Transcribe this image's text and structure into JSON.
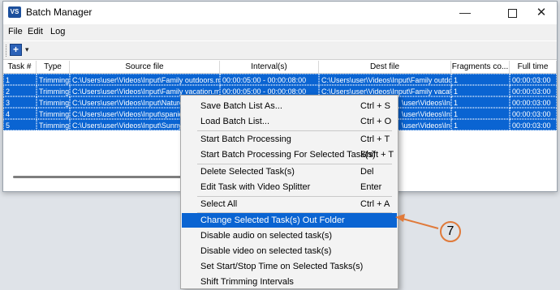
{
  "window": {
    "title": "Batch Manager",
    "app_icon": "VS"
  },
  "window_controls": {
    "minimize": "—",
    "close": "✕"
  },
  "menu": [
    "File",
    "Edit",
    "Log"
  ],
  "toolbar": {
    "add_icon": "+",
    "dropdown_icon": "▾"
  },
  "table": {
    "columns": [
      "Task #",
      "Type",
      "Source file",
      "Interval(s)",
      "Dest file",
      "Fragments co...",
      "Full time"
    ],
    "rows": [
      [
        "1",
        "Trimming",
        "C:\\Users\\user\\Videos\\Input\\Family outdoors.mp",
        "00:00:05:00 - 00:00:08:00",
        "C:\\Users\\user\\Videos\\Input\\Family outdo",
        "1",
        "00:00:03:00"
      ],
      [
        "2",
        "Trimming",
        "C:\\Users\\user\\Videos\\Input\\Family vacation.mp",
        "00:00:05:00 - 00:00:08:00",
        "C:\\Users\\user\\Videos\\Input\\Family vacat",
        "1",
        "00:00:03:00"
      ],
      [
        "3",
        "Trimming",
        "C:\\Users\\user\\Videos\\Input\\Nature",
        "",
        "\\user\\Videos\\Input\\Nature_Sea_",
        "1",
        "00:00:03:00"
      ],
      [
        "4",
        "Trimming",
        "C:\\Users\\user\\Videos\\Input\\spaniel",
        "",
        "\\user\\Videos\\Input\\spaniel_dog_",
        "1",
        "00:00:03:00"
      ],
      [
        "5",
        "Trimming",
        "C:\\Users\\user\\Videos\\Input\\Sunny",
        "",
        "\\user\\Videos\\Input\\Sunny day_T",
        "1",
        "00:00:03:00"
      ]
    ]
  },
  "context_menu": {
    "items": [
      {
        "label": "Save Batch List As...",
        "shortcut": "Ctrl + S"
      },
      {
        "label": "Load Batch List...",
        "shortcut": "Ctrl + O"
      },
      {
        "label": "Start Batch Processing",
        "shortcut": "Ctrl + T"
      },
      {
        "label": "Start Batch Processing For Selected Task(s)",
        "shortcut": "Shift + T"
      },
      {
        "label": "Delete Selected Task(s)",
        "shortcut": "Del"
      },
      {
        "label": "Edit Task with Video Splitter",
        "shortcut": "Enter"
      },
      {
        "label": "Select All",
        "shortcut": "Ctrl + A"
      },
      {
        "label": "Change Selected Task(s) Out Folder",
        "shortcut": ""
      },
      {
        "label": "Disable audio on selected task(s)",
        "shortcut": ""
      },
      {
        "label": "Disable video on selected task(s)",
        "shortcut": ""
      },
      {
        "label": "Set Start/Stop Time on Selected Tasks(s)",
        "shortcut": ""
      },
      {
        "label": "Shift Trimming Intervals",
        "shortcut": ""
      }
    ],
    "highlighted_index": 7
  },
  "callout": {
    "number": "7"
  },
  "colors": {
    "selection": "#0a64d2",
    "callout": "#e07a3a"
  }
}
